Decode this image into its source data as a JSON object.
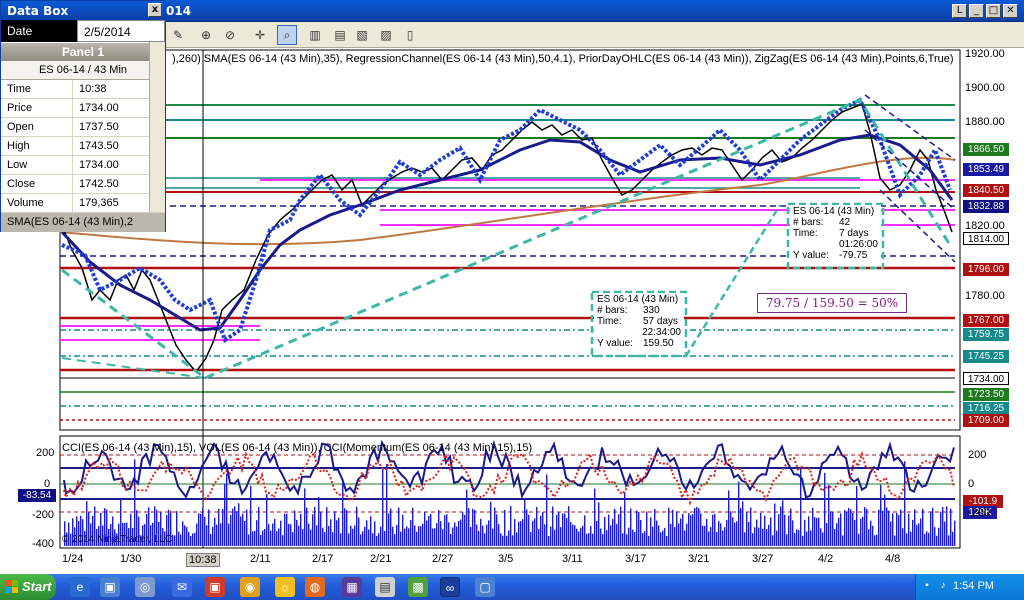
{
  "window": {
    "title": "014",
    "controls": [
      "_",
      "□",
      "✕"
    ],
    "restore_glyph": "L"
  },
  "indicators_header": "),260)  SMA(ES 06-14 (43 Min),35), RegressionChannel(ES 06-14 (43 Min),50,4.1), PriorDayOHLC(ES 06-14 (43 Min)), ZigZag(ES 06-14 (43 Min),Points,6,True)",
  "lower_header": "CCI(ES 06-14 (43 Min),15), VOL(ES 06-14 (43 Min)), CCI(Momentum(ES 06-14 (43 Min),15),15)",
  "copyright": "© 2014 NinjaTrader, LLC",
  "price_axis": [
    "1920.00",
    "1900.00",
    "1880.00",
    "1820.00",
    "1780.00"
  ],
  "price_tags": [
    {
      "label": "1866.50",
      "bg": "#1f7a1f",
      "fg": "#ffffff"
    },
    {
      "label": "1853.49",
      "bg": "#1a1aa0",
      "fg": "#ffffff"
    },
    {
      "label": "1840.50",
      "bg": "#b01010",
      "fg": "#ffffff"
    },
    {
      "label": "1832.88",
      "bg": "#101080",
      "fg": "#ffffff"
    },
    {
      "label": "1814.00",
      "bg": "#ffffff",
      "fg": "#000000"
    },
    {
      "label": "1796.00",
      "bg": "#b01010",
      "fg": "#ffffff"
    },
    {
      "label": "1767.00",
      "bg": "#b01010",
      "fg": "#ffffff"
    },
    {
      "label": "1759.75",
      "bg": "#168a8a",
      "fg": "#ffffff"
    },
    {
      "label": "1745.25",
      "bg": "#168a8a",
      "fg": "#ffffff"
    },
    {
      "label": "1734.00",
      "bg": "#ffffff",
      "fg": "#000000"
    },
    {
      "label": "1723.50",
      "bg": "#1f7a1f",
      "fg": "#ffffff"
    },
    {
      "label": "1716.25",
      "bg": "#168a8a",
      "fg": "#ffffff"
    },
    {
      "label": "1709.00",
      "bg": "#b01010",
      "fg": "#ffffff"
    }
  ],
  "cci_axis": [
    "200",
    "0",
    "-200",
    "-400"
  ],
  "cci_axis_right": [
    "200",
    "0",
    "-200"
  ],
  "cci_tags": [
    {
      "label": "-83.54",
      "bg": "#101080",
      "fg": "#ffffff"
    },
    {
      "label": "-101.9",
      "bg": "#b01010",
      "fg": "#ffffff"
    },
    {
      "label": "129K",
      "bg": "#1a1aa0",
      "fg": "#ffffff"
    }
  ],
  "x_axis": [
    "1/24",
    "1/30",
    "10:38",
    "2/11",
    "2/17",
    "2/21",
    "2/27",
    "3/5",
    "3/11",
    "3/17",
    "3/21",
    "3/27",
    "4/2",
    "4/8"
  ],
  "databox": {
    "title": "Data Box",
    "close": "x",
    "date_label": "Date",
    "date_value": "2/5/2014",
    "panel": "Panel 1",
    "instrument": "ES 06-14 / 43 Min",
    "rows": [
      {
        "k": "Time",
        "v": "10:38"
      },
      {
        "k": "Price",
        "v": "1734.00"
      },
      {
        "k": "Open",
        "v": "1737.50"
      },
      {
        "k": "High",
        "v": "1743.50"
      },
      {
        "k": "Low",
        "v": "1734.00"
      },
      {
        "k": "Close",
        "v": "1742.50"
      },
      {
        "k": "Volume",
        "v": "179,365"
      }
    ],
    "sma_row": "SMA(ES 06-14 (43 Min),2"
  },
  "info_box_1": {
    "title": "ES 06-14 (43 Min)",
    "rows": [
      {
        "k": "# bars:",
        "v": "330"
      },
      {
        "k": "Time:",
        "v": "57 days"
      },
      {
        "k": "",
        "v": "22:34:00"
      },
      {
        "k": "Y value:",
        "v": "159.50"
      }
    ]
  },
  "info_box_2": {
    "title": "ES 06-14 (43 Min)",
    "rows": [
      {
        "k": "# bars:",
        "v": "42"
      },
      {
        "k": "Time:",
        "v": "7 days"
      },
      {
        "k": "",
        "v": "01:26:00"
      },
      {
        "k": "Y value:",
        "v": "-79.75"
      }
    ]
  },
  "annotation": "79.75 / 159.50 = 50%",
  "taskbar": {
    "start": "Start",
    "clock": "1:54 PM"
  },
  "colors": {
    "price_line": "#000000",
    "sma": "#1a1a8a",
    "zigzag": "#3cb8a8",
    "dots": "#1e3cd8",
    "resistance": "#b01010",
    "magenta": "#ff2cff",
    "teal": "#168a8a"
  }
}
